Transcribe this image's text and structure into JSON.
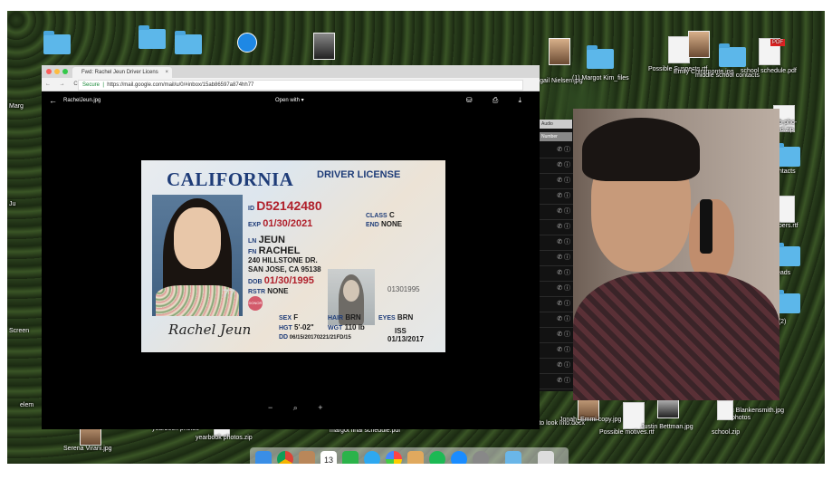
{
  "browser": {
    "tab_title": "Fwd: Rachel Jeun Driver Licens",
    "tab_close": "×",
    "secure_label": "Secure",
    "url": "https://mail.google.com/mail/u/0/#inbox/15ab86597a874hh77",
    "nav_icons": "← → C"
  },
  "viewer": {
    "back_icon": "←",
    "filename": "RachelJeun.jpg",
    "open_with": "Open with ▾",
    "actions": "⛁ ⎙ ⤓",
    "zoom_controls": "− ⌕ +"
  },
  "license": {
    "state": "CALIFORNIA",
    "doc_type": "DRIVER LICENSE",
    "id_label": "ID",
    "id_value": "D52142480",
    "exp_label": "EXP",
    "exp_value": "01/30/2021",
    "class_label": "CLASS",
    "class_value": "C",
    "end_label": "END",
    "end_value": "NONE",
    "ln_label": "LN",
    "ln_value": "JEUN",
    "fn_label": "FN",
    "fn_value": "RACHEL",
    "address1": "240 HILLSTONE DR.",
    "address2": "SAN JOSE, CA 95138",
    "dob_label": "DOB",
    "dob_value": "01/30/1995",
    "rstr_label": "RSTR",
    "rstr_value": "NONE",
    "doc_number": "01301995",
    "sex_label": "SEX",
    "sex_value": "F",
    "hair_label": "HAIR",
    "hair_value": "BRN",
    "eyes_label": "EYES",
    "eyes_value": "BRN",
    "hgt_label": "HGT",
    "hgt_value": "5'-02\"",
    "wgt_label": "WGT",
    "wgt_value": "110 lb",
    "dd_label": "DD",
    "dd_value": "06/15/20170221/21FD/15",
    "iss_label": "ISS",
    "iss_value": "01/13/2017",
    "signature": "Rachel Jeun",
    "donor": "DONOR",
    "photo_overlay": "77"
  },
  "desktop": {
    "left_labels": [
      "Marg",
      "Ju",
      "Screen",
      "elem"
    ],
    "top_labels": {
      "margot_kim_files": "(1) Margot Kim_files",
      "abigail_nielsen": "Abigail Nielsen.jpg",
      "possible_suspects": "Possible Suspects.rtf",
      "emily_chiramonte": "Emily Chiramonte.jpg",
      "middle_school_contacts": "middle school contacts",
      "school_schedule": "school schedule.pdf"
    },
    "right_labels": [
      "fb-pho-",
      "ed.zip",
      "ontacts",
      "mbers.rtf",
      "eads",
      "d (2)"
    ],
    "bottom_labels": {
      "serena": "Serena Virani.jpg",
      "yearbook_photos": "yearbook photos",
      "yearbook_photos_zip": "yearbook photos.zip",
      "margot_final": "margot final schedule.pdf",
      "cb0": "cb0-e113488aa430",
      "details": "Details to look into.docx",
      "jonah": "Jonah_Emmi copy.jpg",
      "possible_motives": "Possible motives.rtf",
      "justin": "Justin Bettman.jpg",
      "isaac": "Isaac Blankensmith.jpg",
      "school_zip": "school.zip",
      "photos": "photos"
    }
  },
  "contacts": {
    "header": "Audio",
    "sub": "Number",
    "row_icons": "✆ ⓘ"
  },
  "dock": {
    "apps": [
      "finder",
      "chrome",
      "contacts",
      "calendar",
      "facetime",
      "messages",
      "photos",
      "preview",
      "spotify",
      "app-store",
      "system-preferences",
      "downloads",
      "trash"
    ],
    "calendar_day": "13"
  },
  "colors": {
    "license_blue": "#1e3c78",
    "license_red": "#b0202b",
    "secure_green": "#1b8a3a",
    "folder_blue": "#5cb7ea"
  }
}
